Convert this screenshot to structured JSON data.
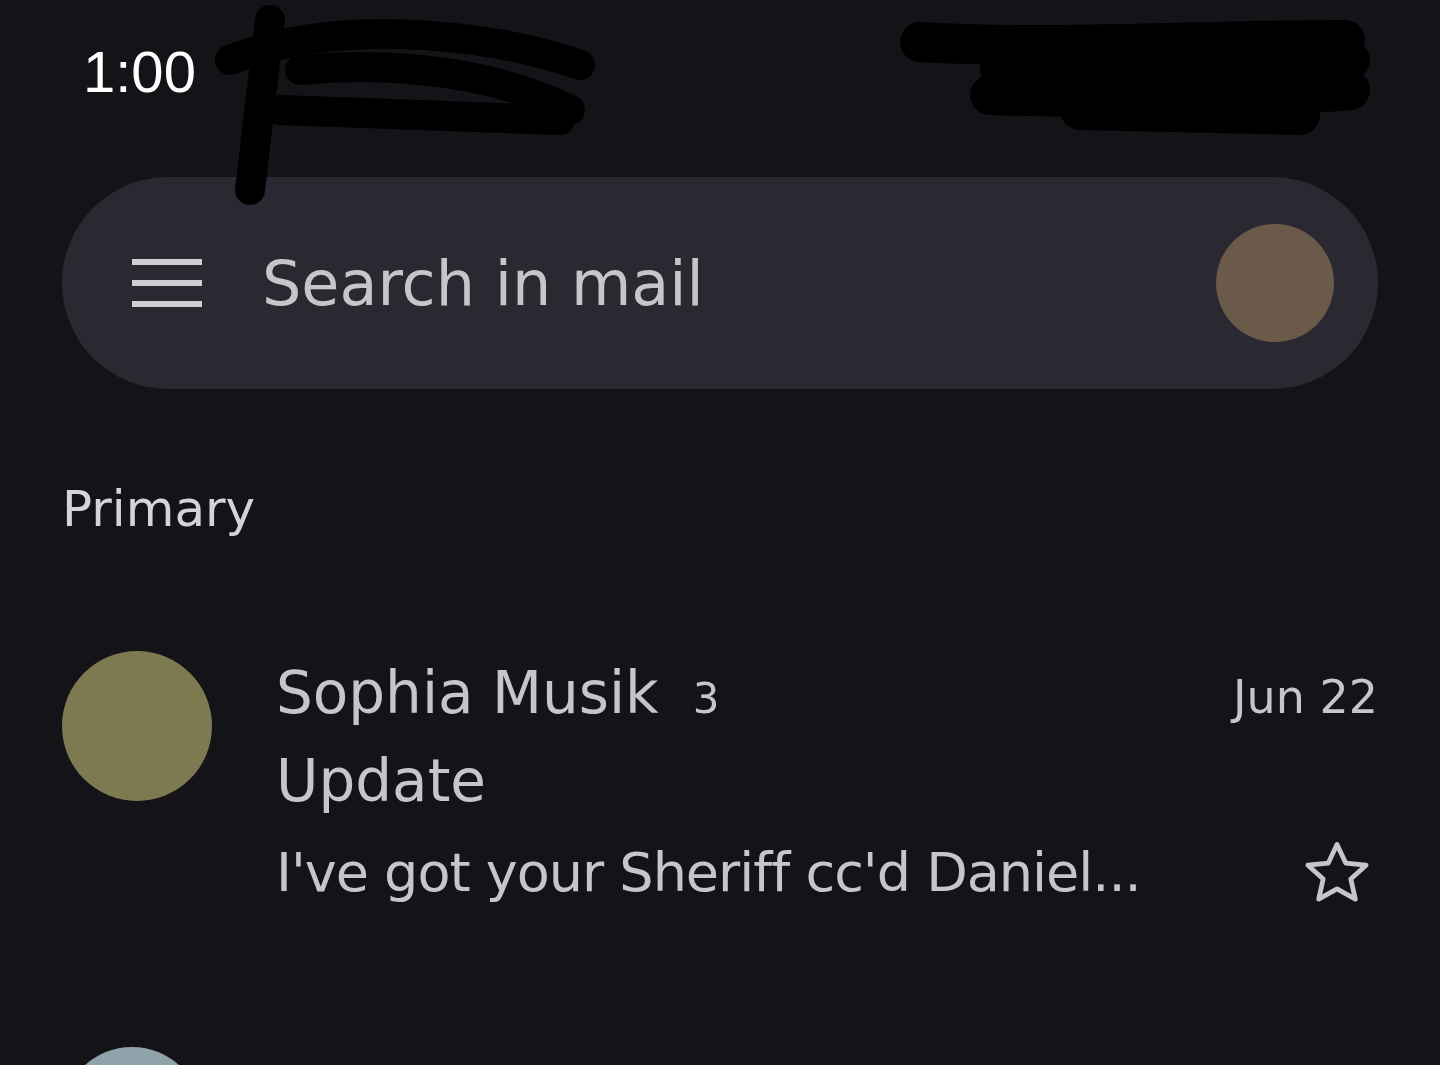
{
  "status_bar": {
    "time": "1:00"
  },
  "search": {
    "placeholder": "Search in mail"
  },
  "section": {
    "title": "Primary"
  },
  "messages": [
    {
      "sender": "Sophia Musik",
      "count": "3",
      "date": "Jun 22",
      "subject": "Update",
      "snippet": "I've got your Sheriff cc'd Daniel...",
      "starred": false
    }
  ]
}
